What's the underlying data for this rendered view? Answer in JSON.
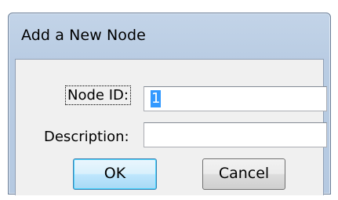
{
  "dialog": {
    "title": "Add a New Node",
    "node_id_label": "Node ID:",
    "node_id_value": "1",
    "description_label": "Description:",
    "description_value": "",
    "ok_label": "OK",
    "cancel_label": "Cancel"
  },
  "colors": {
    "frame": "#b9cce3",
    "client": "#f0f0f0",
    "selection": "#3399ff"
  }
}
